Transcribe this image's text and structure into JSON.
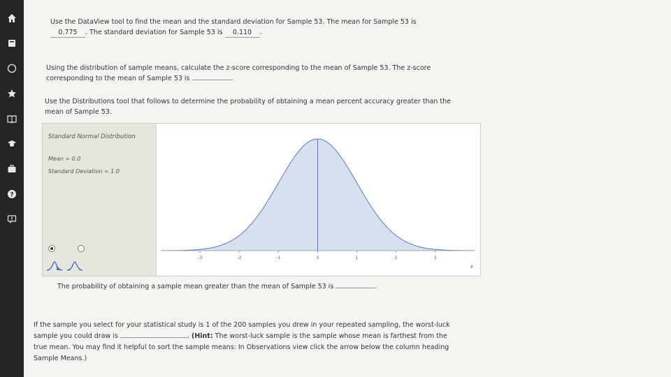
{
  "sidebar": {
    "icons": [
      "home-icon",
      "book-icon",
      "compass-icon",
      "star-icon",
      "open-book-icon",
      "graduation-cap-icon",
      "briefcase-icon",
      "help-icon",
      "feedback-icon"
    ]
  },
  "q1": {
    "text1": "Use the DataView tool to find the mean and the standard deviation for Sample 53. The mean for Sample 53 is",
    "mean_value": "0.775",
    "text2": ". The standard deviation for Sample 53 is",
    "sd_value": "0.110",
    "text3": "."
  },
  "q2": {
    "text1": "Using the distribution of sample means, calculate the z-score corresponding to the mean of Sample 53. The z-score corresponding to the mean of Sample 53 is",
    "answer": "",
    "text2": "."
  },
  "q3": {
    "text": "Use the Distributions tool that follows to determine the probability of obtaining a mean percent accuracy greater than the mean of Sample 53."
  },
  "tool": {
    "title": "Standard Normal Distribution",
    "mean_label": "Mean = 0.0",
    "sd_label": "Standard Deviation = 1.0",
    "radio_selected": 0,
    "accent": "#4a6fc4"
  },
  "chart_data": {
    "type": "area",
    "title": "",
    "distribution": "standard normal",
    "mean": 0.0,
    "sd": 1.0,
    "xlim": [
      -4,
      4
    ],
    "x_ticks": [
      "-3",
      "-2",
      "-1",
      "0",
      "1",
      "2",
      "3"
    ],
    "x_tick_values": [
      -3,
      -2,
      -1,
      0,
      1,
      2,
      3
    ],
    "xlabel": "z",
    "marker_line": 0,
    "fill_color": "#d7e0ee",
    "line_color": "#5a7bbf"
  },
  "q4": {
    "text1": "The probability of obtaining a sample mean greater than the mean of Sample 53 is",
    "answer": "",
    "text2": "."
  },
  "q5": {
    "text1": "If the sample you select for your statistical study is 1 of the 200 samples you drew in your repeated sampling, the worst-luck sample you could draw is",
    "answer": "",
    "text2": ". ",
    "hint_label": "(Hint:",
    "text3": " The worst-luck sample is the sample whose mean is farthest from the true mean. You may find it helpful to sort the sample means: In Observations view click the arrow below the column heading Sample Means.)"
  }
}
